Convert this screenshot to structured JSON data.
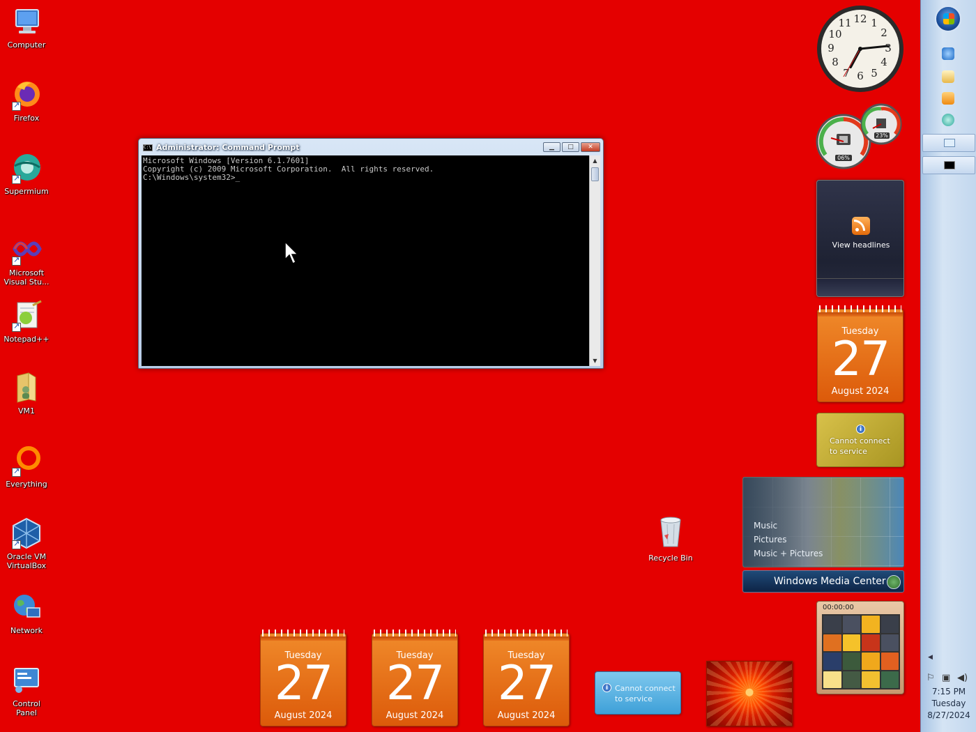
{
  "desktop": {
    "icons": [
      {
        "label": "Computer"
      },
      {
        "label": "Firefox"
      },
      {
        "label": "Supermium"
      },
      {
        "label": "Microsoft Visual Stu..."
      },
      {
        "label": "Notepad++"
      },
      {
        "label": "VM1"
      },
      {
        "label": "Everything"
      },
      {
        "label": "Oracle VM VirtualBox"
      },
      {
        "label": "Network"
      },
      {
        "label": "Control Panel"
      }
    ],
    "recycle_bin": "Recycle Bin"
  },
  "cmd_window": {
    "title": "Administrator: Command Prompt",
    "icon_text": "C:\\",
    "line1": "Microsoft Windows [Version 6.1.7601]",
    "line2": "Copyright (c) 2009 Microsoft Corporation.  All rights reserved.",
    "line3": "",
    "prompt": "C:\\Windows\\system32>_"
  },
  "gadgets": {
    "cpu_meter": {
      "cpu": "06%",
      "memory": "23%"
    },
    "feed_headlines": {
      "label": "View headlines"
    },
    "calendar": {
      "weekday": "Tuesday",
      "day": "27",
      "month_year": "August 2024"
    },
    "weather": {
      "line1": "Cannot connect",
      "line2": "to service"
    },
    "media_center": {
      "items": [
        "Music",
        "Pictures",
        "Music + Pictures"
      ],
      "title": "Windows Media Center"
    },
    "puzzle": {
      "timer": "00:00:00"
    },
    "currency": {
      "line1": "Cannot connect",
      "line2": "to service"
    }
  },
  "taskbar": {
    "time": "7:15 PM",
    "weekday": "Tuesday",
    "date": "8/27/2024"
  },
  "colors": {
    "desktop_background": "#e40000",
    "calendar_orange": "#e8701a",
    "taskbar_blue": "#c2d7ee"
  }
}
